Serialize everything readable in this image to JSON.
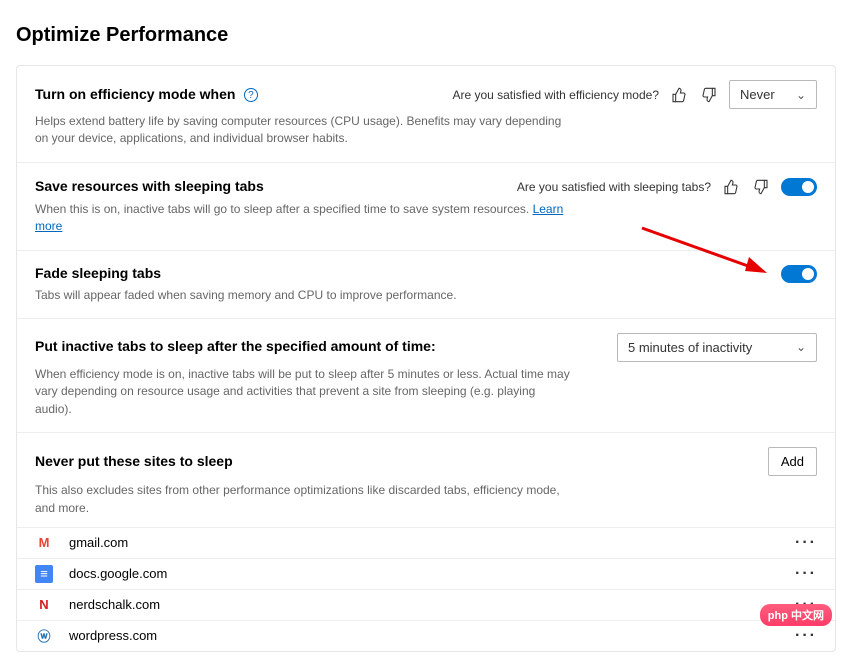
{
  "page_title": "Optimize Performance",
  "efficiency": {
    "title": "Turn on efficiency mode when",
    "desc": "Helps extend battery life by saving computer resources (CPU usage). Benefits may vary depending on your device, applications, and individual browser habits.",
    "satisfied_prompt": "Are you satisfied with efficiency mode?",
    "select_value": "Never"
  },
  "sleeping": {
    "title": "Save resources with sleeping tabs",
    "desc_pre": "When this is on, inactive tabs will go to sleep after a specified time to save system resources. ",
    "learn_more": "Learn more",
    "satisfied_prompt": "Are you satisfied with sleeping tabs?"
  },
  "fade": {
    "title": "Fade sleeping tabs",
    "desc": "Tabs will appear faded when saving memory and CPU to improve performance."
  },
  "inactive": {
    "title": "Put inactive tabs to sleep after the specified amount of time:",
    "desc": "When efficiency mode is on, inactive tabs will be put to sleep after 5 minutes or less. Actual time may vary depending on resource usage and activities that prevent a site from sleeping (e.g. playing audio).",
    "select_value": "5 minutes of inactivity"
  },
  "never_sleep": {
    "title": "Never put these sites to sleep",
    "desc": "This also excludes sites from other performance optimizations like discarded tabs, efficiency mode, and more.",
    "add_label": "Add",
    "sites": [
      {
        "name": "gmail.com",
        "icon": "M",
        "color": "#ea4335",
        "bg": "#fff"
      },
      {
        "name": "docs.google.com",
        "icon": "≡",
        "color": "#fff",
        "bg": "#4285f4"
      },
      {
        "name": "nerdschalk.com",
        "icon": "N",
        "color": "#d11d1d",
        "bg": "#fff"
      },
      {
        "name": "wordpress.com",
        "icon": "ⓦ",
        "color": "#2271b1",
        "bg": "#fff"
      }
    ]
  },
  "watermark": "php 中文网"
}
